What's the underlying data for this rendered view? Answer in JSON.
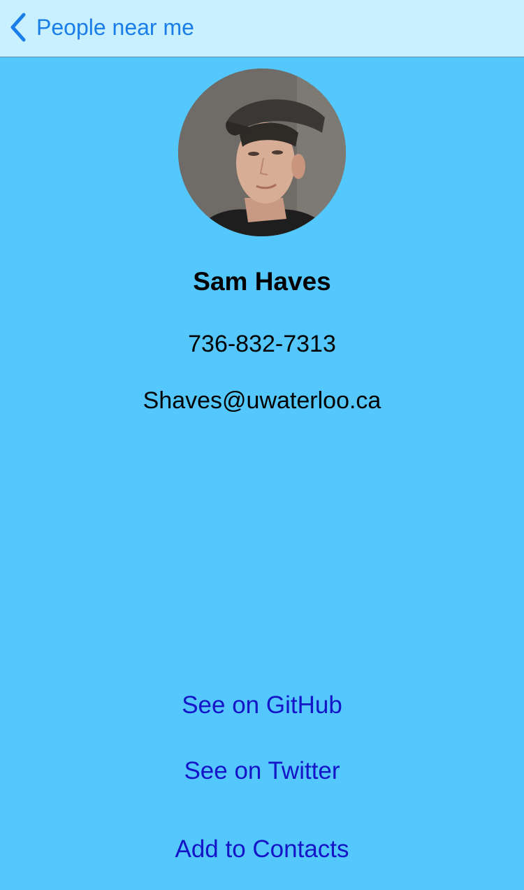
{
  "nav": {
    "back_label": "People near me",
    "back_icon": "chevron-left-icon"
  },
  "profile": {
    "avatar": "profile-photo",
    "name": "Sam Haves",
    "phone": "736-832-7313",
    "email": "Shaves@uwaterloo.ca"
  },
  "actions": {
    "github_label": "See on GitHub",
    "twitter_label": "See on Twitter",
    "contacts_label": "Add to Contacts"
  },
  "colors": {
    "background": "#54c7fc",
    "navbar": "#c8f0ff",
    "nav_tint": "#1a7de8",
    "link": "#1414c8"
  }
}
